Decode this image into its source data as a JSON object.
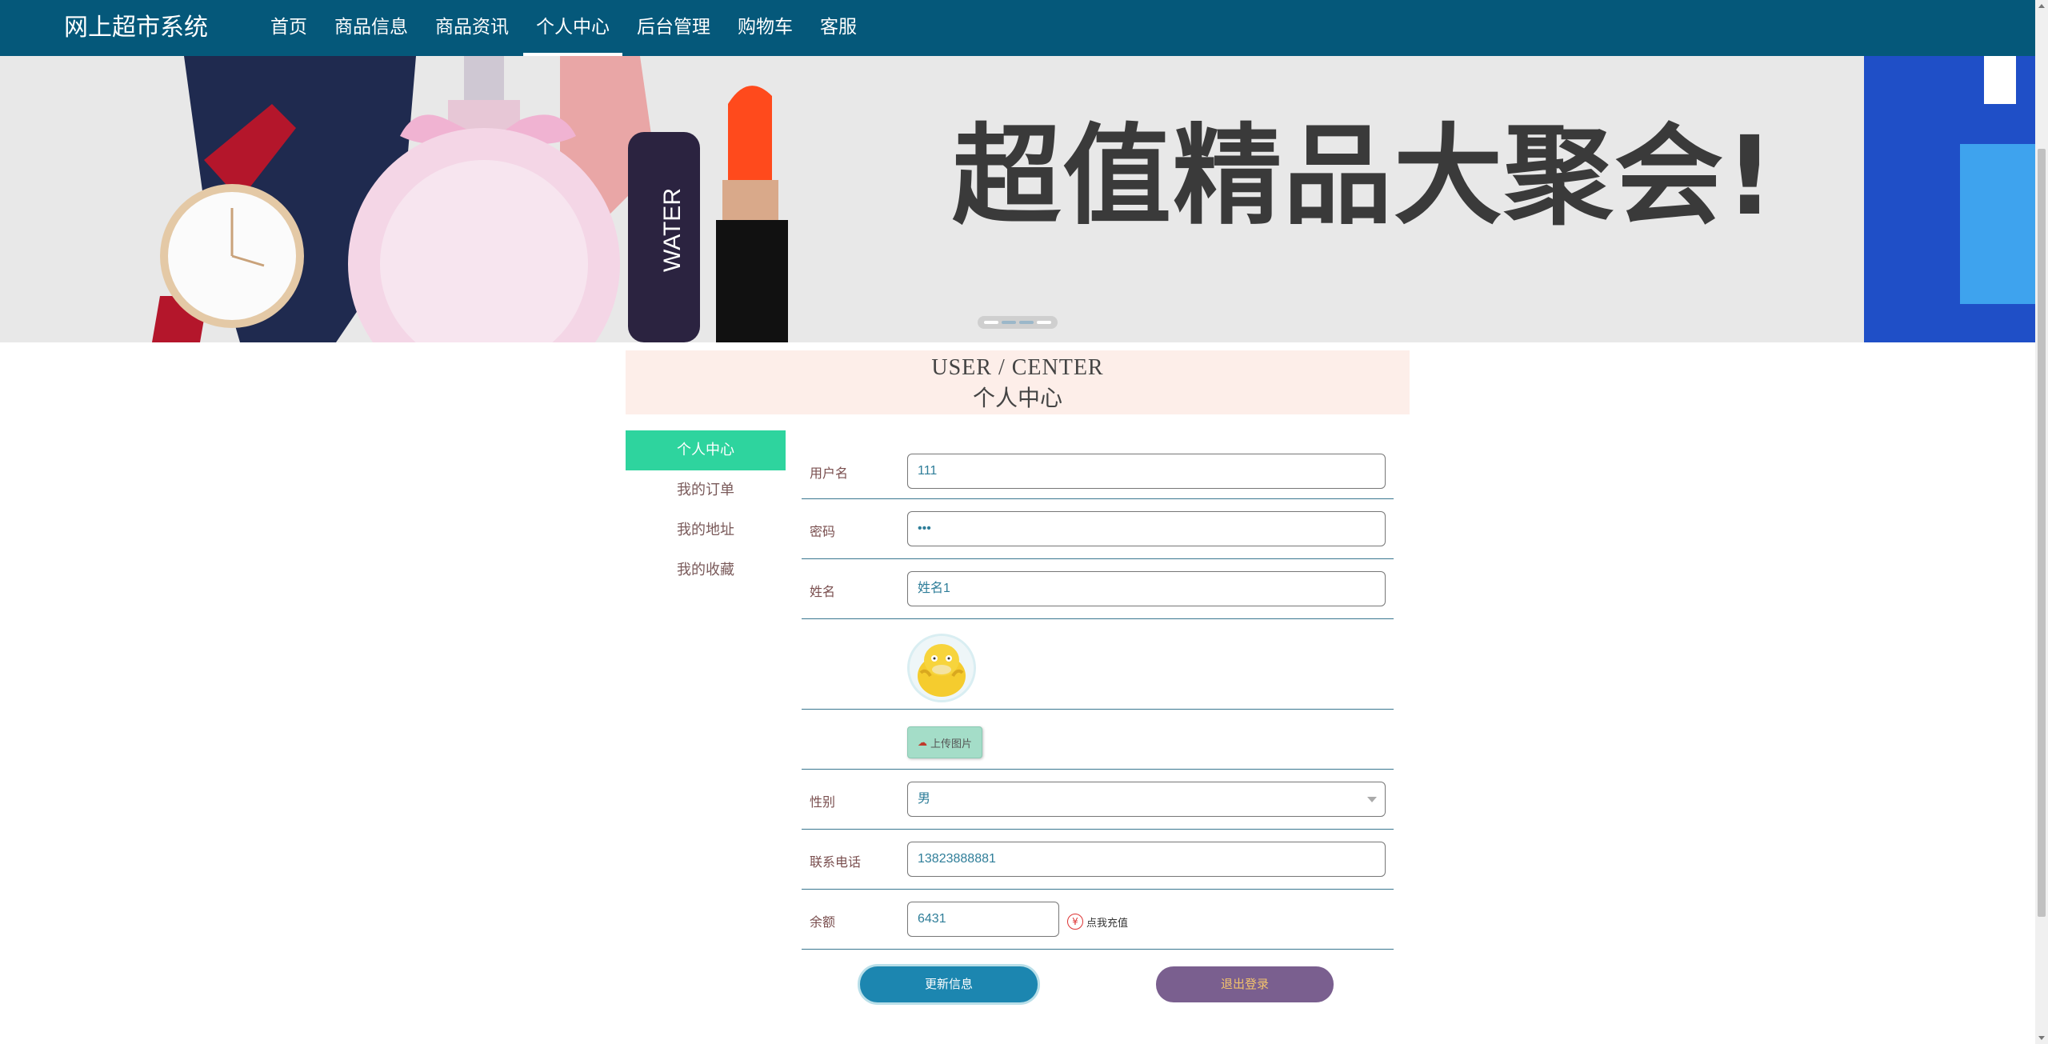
{
  "nav": {
    "brand": "网上超市系统",
    "items": [
      {
        "label": "首页",
        "active": false
      },
      {
        "label": "商品信息",
        "active": false
      },
      {
        "label": "商品资讯",
        "active": false
      },
      {
        "label": "个人中心",
        "active": true
      },
      {
        "label": "后台管理",
        "active": false
      },
      {
        "label": "购物车",
        "active": false
      },
      {
        "label": "客服",
        "active": false
      }
    ]
  },
  "banner": {
    "headline": "超值精品大聚会!",
    "lipstick_text": "WATER"
  },
  "section": {
    "title_en": "USER / CENTER",
    "title_cn": "个人中心"
  },
  "side_menu": {
    "items": [
      {
        "label": "个人中心",
        "active": true
      },
      {
        "label": "我的订单",
        "active": false
      },
      {
        "label": "我的地址",
        "active": false
      },
      {
        "label": "我的收藏",
        "active": false
      }
    ]
  },
  "form": {
    "username_label": "用户名",
    "username_value": "111",
    "password_label": "密码",
    "password_value": "•••",
    "name_label": "姓名",
    "name_value": "姓名1",
    "upload_label": "上传图片",
    "gender_label": "性别",
    "gender_value": "男",
    "phone_label": "联系电话",
    "phone_value": "13823888881",
    "balance_label": "余额",
    "balance_value": "6431",
    "recharge_label": "点我充值",
    "update_button": "更新信息",
    "logout_button": "退出登录"
  },
  "colors": {
    "nav_bg": "#05587a",
    "side_active": "#2ed49e",
    "section_bg": "#fdeee9",
    "update_btn": "#1c86b0",
    "logout_btn": "#7a5f8f",
    "logout_text": "#f3c36c"
  }
}
